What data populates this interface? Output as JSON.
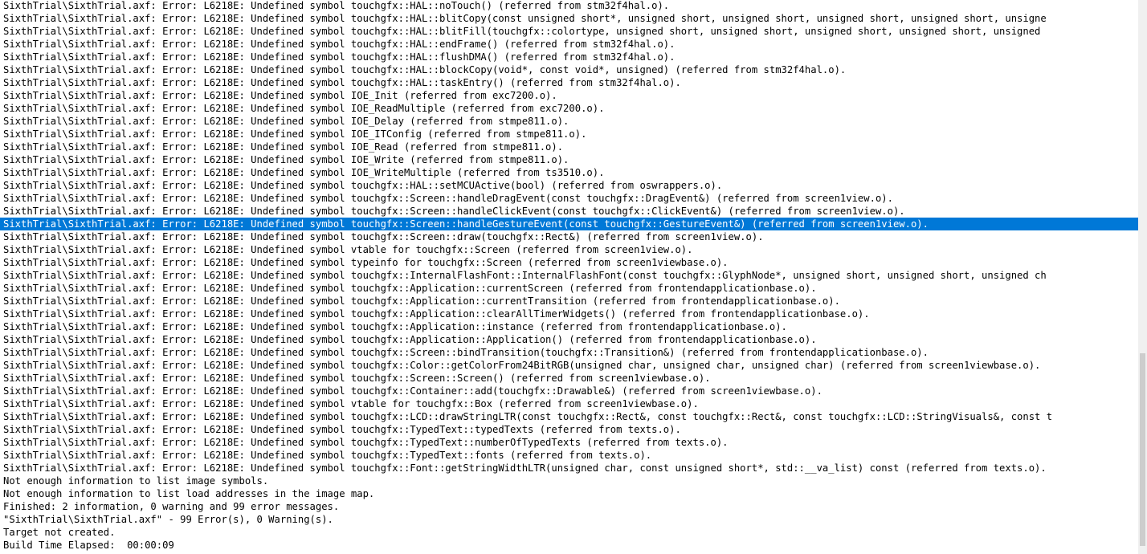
{
  "build_output": {
    "lines": [
      "SixthTrial\\SixthTrial.axf: Error: L6218E: Undefined symbol touchgfx::HAL::noTouch() (referred from stm32f4hal.o).",
      "SixthTrial\\SixthTrial.axf: Error: L6218E: Undefined symbol touchgfx::HAL::blitCopy(const unsigned short*, unsigned short, unsigned short, unsigned short, unsigned short, unsigne",
      "SixthTrial\\SixthTrial.axf: Error: L6218E: Undefined symbol touchgfx::HAL::blitFill(touchgfx::colortype, unsigned short, unsigned short, unsigned short, unsigned short, unsigned",
      "SixthTrial\\SixthTrial.axf: Error: L6218E: Undefined symbol touchgfx::HAL::endFrame() (referred from stm32f4hal.o).",
      "SixthTrial\\SixthTrial.axf: Error: L6218E: Undefined symbol touchgfx::HAL::flushDMA() (referred from stm32f4hal.o).",
      "SixthTrial\\SixthTrial.axf: Error: L6218E: Undefined symbol touchgfx::HAL::blockCopy(void*, const void*, unsigned) (referred from stm32f4hal.o).",
      "SixthTrial\\SixthTrial.axf: Error: L6218E: Undefined symbol touchgfx::HAL::taskEntry() (referred from stm32f4hal.o).",
      "SixthTrial\\SixthTrial.axf: Error: L6218E: Undefined symbol IOE_Init (referred from exc7200.o).",
      "SixthTrial\\SixthTrial.axf: Error: L6218E: Undefined symbol IOE_ReadMultiple (referred from exc7200.o).",
      "SixthTrial\\SixthTrial.axf: Error: L6218E: Undefined symbol IOE_Delay (referred from stmpe811.o).",
      "SixthTrial\\SixthTrial.axf: Error: L6218E: Undefined symbol IOE_ITConfig (referred from stmpe811.o).",
      "SixthTrial\\SixthTrial.axf: Error: L6218E: Undefined symbol IOE_Read (referred from stmpe811.o).",
      "SixthTrial\\SixthTrial.axf: Error: L6218E: Undefined symbol IOE_Write (referred from stmpe811.o).",
      "SixthTrial\\SixthTrial.axf: Error: L6218E: Undefined symbol IOE_WriteMultiple (referred from ts3510.o).",
      "SixthTrial\\SixthTrial.axf: Error: L6218E: Undefined symbol touchgfx::HAL::setMCUActive(bool) (referred from oswrappers.o).",
      "SixthTrial\\SixthTrial.axf: Error: L6218E: Undefined symbol touchgfx::Screen::handleDragEvent(const touchgfx::DragEvent&) (referred from screen1view.o).",
      "SixthTrial\\SixthTrial.axf: Error: L6218E: Undefined symbol touchgfx::Screen::handleClickEvent(const touchgfx::ClickEvent&) (referred from screen1view.o).",
      "SixthTrial\\SixthTrial.axf: Error: L6218E: Undefined symbol touchgfx::Screen::handleGestureEvent(const touchgfx::GestureEvent&) (referred from screen1view.o).",
      "SixthTrial\\SixthTrial.axf: Error: L6218E: Undefined symbol touchgfx::Screen::draw(touchgfx::Rect&) (referred from screen1view.o).",
      "SixthTrial\\SixthTrial.axf: Error: L6218E: Undefined symbol vtable for touchgfx::Screen (referred from screen1view.o).",
      "SixthTrial\\SixthTrial.axf: Error: L6218E: Undefined symbol typeinfo for touchgfx::Screen (referred from screen1viewbase.o).",
      "SixthTrial\\SixthTrial.axf: Error: L6218E: Undefined symbol touchgfx::InternalFlashFont::InternalFlashFont(const touchgfx::GlyphNode*, unsigned short, unsigned short, unsigned ch",
      "SixthTrial\\SixthTrial.axf: Error: L6218E: Undefined symbol touchgfx::Application::currentScreen (referred from frontendapplicationbase.o).",
      "SixthTrial\\SixthTrial.axf: Error: L6218E: Undefined symbol touchgfx::Application::currentTransition (referred from frontendapplicationbase.o).",
      "SixthTrial\\SixthTrial.axf: Error: L6218E: Undefined symbol touchgfx::Application::clearAllTimerWidgets() (referred from frontendapplicationbase.o).",
      "SixthTrial\\SixthTrial.axf: Error: L6218E: Undefined symbol touchgfx::Application::instance (referred from frontendapplicationbase.o).",
      "SixthTrial\\SixthTrial.axf: Error: L6218E: Undefined symbol touchgfx::Application::Application() (referred from frontendapplicationbase.o).",
      "SixthTrial\\SixthTrial.axf: Error: L6218E: Undefined symbol touchgfx::Screen::bindTransition(touchgfx::Transition&) (referred from frontendapplicationbase.o).",
      "SixthTrial\\SixthTrial.axf: Error: L6218E: Undefined symbol touchgfx::Color::getColorFrom24BitRGB(unsigned char, unsigned char, unsigned char) (referred from screen1viewbase.o).",
      "SixthTrial\\SixthTrial.axf: Error: L6218E: Undefined symbol touchgfx::Screen::Screen() (referred from screen1viewbase.o).",
      "SixthTrial\\SixthTrial.axf: Error: L6218E: Undefined symbol touchgfx::Container::add(touchgfx::Drawable&) (referred from screen1viewbase.o).",
      "SixthTrial\\SixthTrial.axf: Error: L6218E: Undefined symbol vtable for touchgfx::Box (referred from screen1viewbase.o).",
      "SixthTrial\\SixthTrial.axf: Error: L6218E: Undefined symbol touchgfx::LCD::drawStringLTR(const touchgfx::Rect&, const touchgfx::Rect&, const touchgfx::LCD::StringVisuals&, const t",
      "SixthTrial\\SixthTrial.axf: Error: L6218E: Undefined symbol touchgfx::TypedText::typedTexts (referred from texts.o).",
      "SixthTrial\\SixthTrial.axf: Error: L6218E: Undefined symbol touchgfx::TypedText::numberOfTypedTexts (referred from texts.o).",
      "SixthTrial\\SixthTrial.axf: Error: L6218E: Undefined symbol touchgfx::TypedText::fonts (referred from texts.o).",
      "SixthTrial\\SixthTrial.axf: Error: L6218E: Undefined symbol touchgfx::Font::getStringWidthLTR(unsigned char, const unsigned short*, std::__va_list) const (referred from texts.o).",
      "Not enough information to list image symbols.",
      "Not enough information to list load addresses in the image map.",
      "Finished: 2 information, 0 warning and 99 error messages.",
      "\"SixthTrial\\SixthTrial.axf\" - 99 Error(s), 0 Warning(s).",
      "Target not created.",
      "Build Time Elapsed:  00:00:09"
    ],
    "selected_line_index": 17,
    "selection_color": "#0078d7"
  }
}
